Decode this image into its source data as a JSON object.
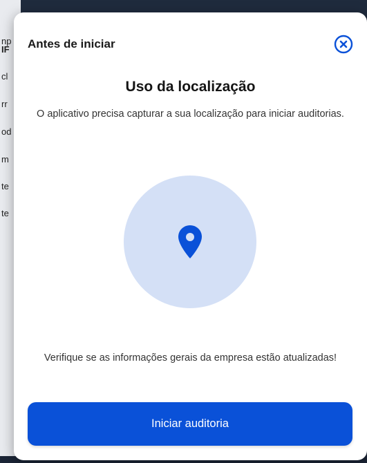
{
  "background": {
    "fragments": [
      {
        "text": "np",
        "bold": false
      },
      {
        "text": "IF",
        "bold": true
      },
      {
        "text": "cl",
        "bold": false
      },
      {
        "text": "rr",
        "bold": false
      },
      {
        "text": "od",
        "bold": false
      },
      {
        "text": "m",
        "bold": false
      },
      {
        "text": "te",
        "bold": false
      },
      {
        "text": "te",
        "bold": false
      }
    ]
  },
  "modal": {
    "title": "Antes de iniciar",
    "close_icon": "close-circle-icon",
    "heading": "Uso da localização",
    "description": "O aplicativo precisa capturar a sua localização para iniciar auditorias.",
    "illustration_icon": "location-pin-icon",
    "notice": "Verifique se as informações gerais da empresa estão atualizadas!",
    "primary_button": "Iniciar auditoria"
  },
  "colors": {
    "accent": "#0a51d8",
    "illustration_bg": "#d4e0f6",
    "overlay": "#0f1d33"
  }
}
